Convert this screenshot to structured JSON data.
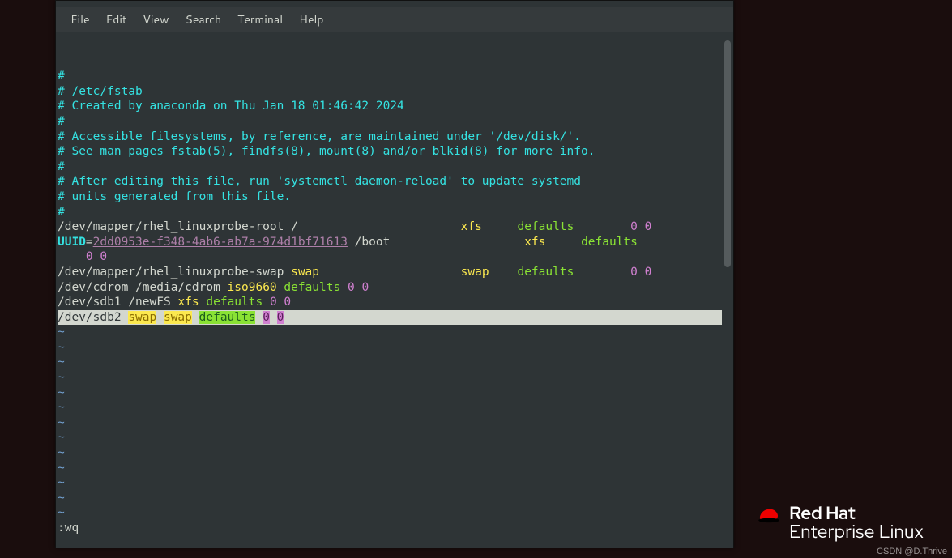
{
  "menubar": {
    "file": "File",
    "edit": "Edit",
    "view": "View",
    "search": "Search",
    "terminal": "Terminal",
    "help": "Help"
  },
  "editor": {
    "comments": [
      "#",
      "# /etc/fstab",
      "# Created by anaconda on Thu Jan 18 01:46:42 2024",
      "#",
      "# Accessible filesystems, by reference, are maintained under '/dev/disk/'.",
      "# See man pages fstab(5), findfs(8), mount(8) and/or blkid(8) for more info.",
      "#",
      "# After editing this file, run 'systemctl daemon-reload' to update systemd",
      "# units generated from this file.",
      "#"
    ],
    "row1": {
      "dev": "/dev/mapper/rhel_linuxprobe-root",
      "mnt": "/",
      "fs": "xfs",
      "opts": "defaults",
      "dump": "0",
      "pass": "0"
    },
    "row2": {
      "uuidlabel": "UUID",
      "eq": "=",
      "uuid": "2dd0953e-f348-4ab6-ab7a-974d1bf71613",
      "mnt": "/boot",
      "fs": "xfs",
      "opts": "defaults",
      "dump": "0",
      "pass": "0"
    },
    "row3": {
      "dev": "/dev/mapper/rhel_linuxprobe-swap",
      "mnt": "swap",
      "fs": "swap",
      "opts": "defaults",
      "dump": "0",
      "pass": "0"
    },
    "row4": {
      "dev": "/dev/cdrom",
      "mnt": "/media/cdrom",
      "fs": "iso9660",
      "opts": "defaults",
      "dump": "0",
      "pass": "0"
    },
    "row5": {
      "dev": "/dev/sdb1",
      "mnt": "/newFS",
      "fs": "xfs",
      "opts": "defaults",
      "dump": "0",
      "pass": "0"
    },
    "row6": {
      "dev": "/dev/sdb2",
      "mnt": "swap",
      "fs": "swap",
      "opts": "defaults",
      "dump": "0",
      "pass": "0"
    },
    "tilde": "~",
    "cmdline": ":wq"
  },
  "branding": {
    "line1": "Red Hat",
    "line2": "Enterprise Linux"
  },
  "watermark": "CSDN @D.Thrive"
}
